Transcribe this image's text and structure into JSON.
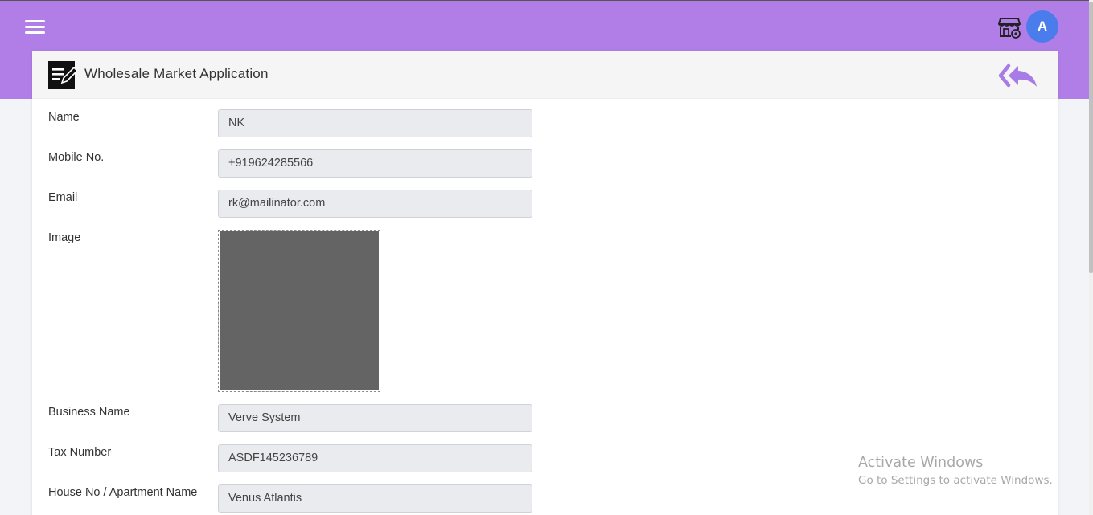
{
  "header": {
    "menu_icon": "hamburger-menu-icon",
    "store_icon": "store-settings-icon",
    "avatar_initial": "A",
    "brand_color": "#b17ee8",
    "avatar_color": "#4a7cec"
  },
  "card": {
    "title": "Wholesale Market Application",
    "title_icon": "edit-document-icon",
    "back_icon": "reply-all-icon"
  },
  "form": {
    "name": {
      "label": "Name",
      "value": "NK"
    },
    "mobile": {
      "label": "Mobile No.",
      "value": "+919624285566"
    },
    "email": {
      "label": "Email",
      "value": "rk@mailinator.com"
    },
    "image": {
      "label": "Image"
    },
    "business_name": {
      "label": "Business Name",
      "value": "Verve System"
    },
    "tax_number": {
      "label": "Tax Number",
      "value": "ASDF145236789"
    },
    "house_no": {
      "label": "House No / Apartment Name",
      "value": "Venus Atlantis"
    }
  },
  "watermark": {
    "line1": "Activate Windows",
    "line2": "Go to Settings to activate Windows."
  }
}
